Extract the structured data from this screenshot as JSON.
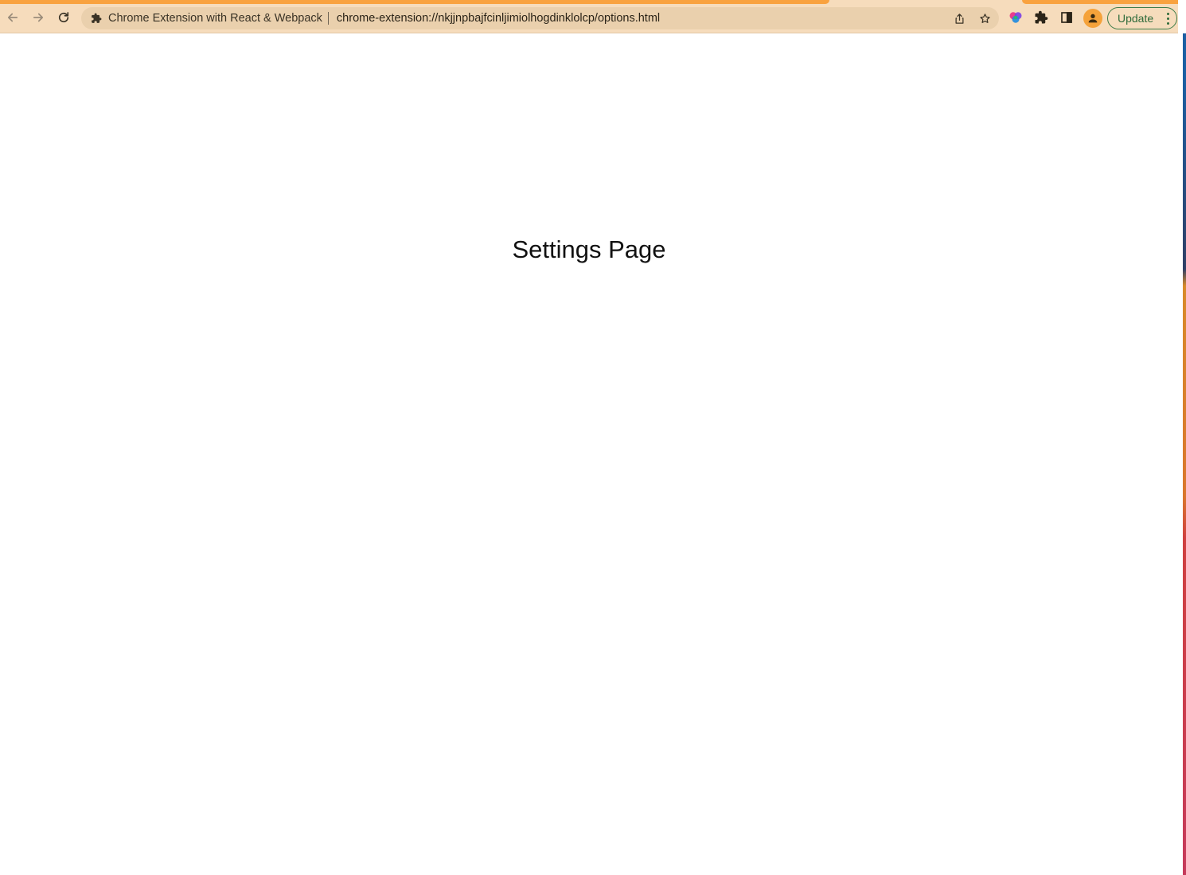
{
  "browser": {
    "omnibox": {
      "site_name": "Chrome Extension with React & Webpack",
      "url": "chrome-extension://nkjjnpbajfcinljimiolhogdinklolcp/options.html"
    },
    "update_button_label": "Update",
    "icons": {
      "back": "arrow-left-icon",
      "forward": "arrow-right-icon",
      "reload": "reload-icon",
      "site": "puzzle-piece-icon",
      "share": "share-icon",
      "bookmark": "star-icon",
      "extension": "colorful-extension-icon",
      "extensions_menu": "puzzle-piece-icon",
      "side_panel": "side-panel-icon",
      "profile": "person-icon",
      "menu": "kebab-menu-icon"
    },
    "colors": {
      "toolbar": "#f6dcbc",
      "omnibox": "#ead0ad",
      "tab_accent": "#f9a23f",
      "update_green": "#2f6b3b",
      "avatar": "#f5a23a"
    }
  },
  "page": {
    "heading": "Settings Page"
  }
}
